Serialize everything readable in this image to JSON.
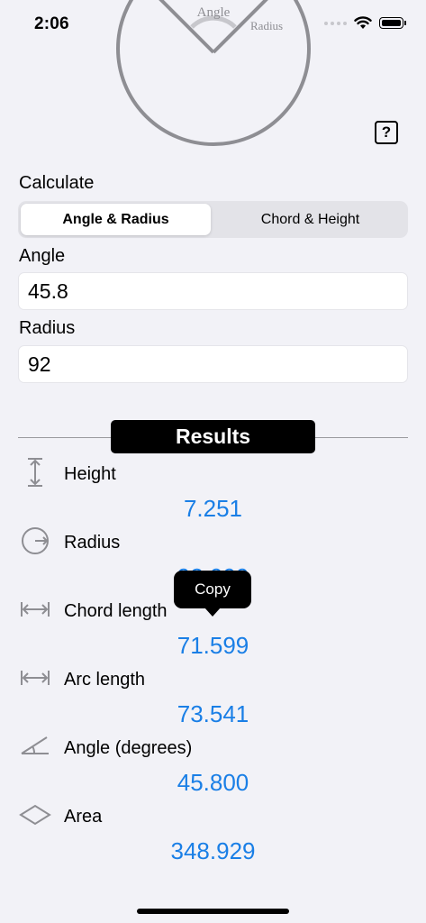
{
  "status_bar": {
    "time": "2:06"
  },
  "diagram": {
    "angle_label": "Angle",
    "radius_label": "Radius"
  },
  "help_button": {
    "label": "?"
  },
  "calculate": {
    "label": "Calculate",
    "segments": [
      "Angle & Radius",
      "Chord & Height"
    ],
    "selected": "Angle & Radius"
  },
  "inputs": {
    "angle": {
      "label": "Angle",
      "value": "45.8"
    },
    "radius": {
      "label": "Radius",
      "value": "92"
    }
  },
  "results": {
    "title": "Results",
    "items": [
      {
        "label": "Height",
        "value": "7.251",
        "icon": "height-icon"
      },
      {
        "label": "Radius",
        "value": "92.000",
        "icon": "radius-icon"
      },
      {
        "label": "Chord length",
        "value": "71.599",
        "icon": "chord-length-icon"
      },
      {
        "label": "Arc length",
        "value": "73.541",
        "icon": "arc-length-icon"
      },
      {
        "label": "Angle (degrees)",
        "value": "45.800",
        "icon": "angle-icon"
      },
      {
        "label": "Area",
        "value": "348.929",
        "icon": "area-icon"
      }
    ]
  },
  "tooltip": {
    "label": "Copy"
  },
  "colors": {
    "value_blue": "#1a7fe6",
    "background": "#f2f2f7"
  }
}
